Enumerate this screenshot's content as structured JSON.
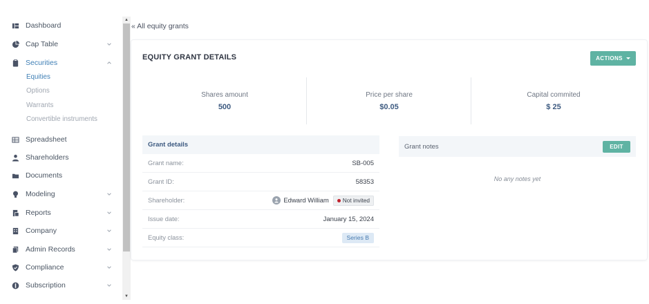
{
  "sidebar": {
    "items": [
      {
        "label": "Dashboard",
        "icon": "dashboard-icon",
        "chevron": ""
      },
      {
        "label": "Cap Table",
        "icon": "pie-chart-icon",
        "chevron": "down"
      },
      {
        "label": "Securities",
        "icon": "clipboard-icon",
        "chevron": "up",
        "active": true
      },
      {
        "label": "Spreadsheet",
        "icon": "spreadsheet-icon",
        "chevron": ""
      },
      {
        "label": "Shareholders",
        "icon": "user-icon",
        "chevron": ""
      },
      {
        "label": "Documents",
        "icon": "folder-icon",
        "chevron": ""
      },
      {
        "label": "Modeling",
        "icon": "lightbulb-icon",
        "chevron": "down"
      },
      {
        "label": "Reports",
        "icon": "reports-icon",
        "chevron": "down"
      },
      {
        "label": "Company",
        "icon": "building-icon",
        "chevron": "down"
      },
      {
        "label": "Admin Records",
        "icon": "records-icon",
        "chevron": "down"
      },
      {
        "label": "Compliance",
        "icon": "shield-icon",
        "chevron": "down"
      },
      {
        "label": "Subscription",
        "icon": "dollar-icon",
        "chevron": "down"
      }
    ],
    "securities_sub": [
      "Equities",
      "Options",
      "Warrants",
      "Convertible instruments"
    ]
  },
  "breadcrumb": {
    "back_label": "« All equity grants"
  },
  "card": {
    "title": "EQUITY GRANT DETAILS",
    "actions_label": "ACTIONS",
    "stats": [
      {
        "label": "Shares amount",
        "value": "500"
      },
      {
        "label": "Price per share",
        "value": "$0.05"
      },
      {
        "label": "Capital commited",
        "value": "$ 25"
      }
    ]
  },
  "grant_details": {
    "heading": "Grant details",
    "grant_name_label": "Grant name:",
    "grant_name": "SB-005",
    "grant_id_label": "Grant ID:",
    "grant_id": "58353",
    "shareholder_label": "Shareholder:",
    "shareholder": "Edward William",
    "invite_status": "Not invited",
    "issue_date_label": "Issue date:",
    "issue_date": "January 15, 2024",
    "equity_class_label": "Equity class:",
    "equity_class": "Series B"
  },
  "grant_notes": {
    "heading": "Grant notes",
    "edit_label": "EDIT",
    "empty_text": "No any notes yet"
  },
  "colors": {
    "accent_teal": "#5fb3a3",
    "active_blue": "#3f7fb5",
    "value_navy": "#3d5a80",
    "status_red": "#c0202b"
  }
}
